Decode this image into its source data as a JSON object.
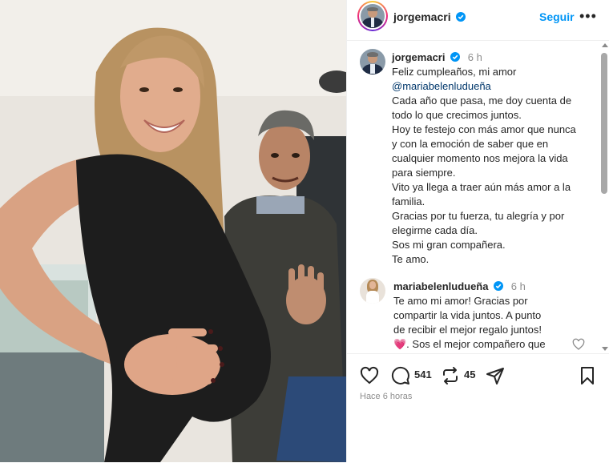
{
  "header": {
    "username": "jorgemacri",
    "follow_label": "Seguir",
    "more_label": "•••"
  },
  "caption": {
    "username": "jorgemacri",
    "time": "6 h",
    "lines": [
      "Feliz cumpleaños, mi amor",
      "@mariabelenludueña",
      "Cada año que pasa, me doy cuenta de",
      "todo lo que crecimos juntos.",
      "Hoy te festejo con más amor que nunca",
      "y con la emoción de saber que en",
      "cualquier momento nos mejora la vida",
      "para siempre.",
      "Vito ya llega a traer aún más amor a la",
      "familia.",
      "Gracias por tu fuerza, tu alegría y por",
      "elegirme cada día.",
      "Sos mi gran compañera.",
      "Te amo."
    ]
  },
  "reply": {
    "username": "mariabelenludueña",
    "time": "6 h",
    "lines": [
      "Te amo mi amor! Gracias por",
      "compartir la vida juntos. A punto",
      "de recibir el mejor regalo juntos!",
      "💗. Sos el mejor compañero que"
    ]
  },
  "actions": {
    "comment_count": "541",
    "repost_count": "45",
    "time_ago": "Hace 6 horas"
  },
  "colors": {
    "accent": "#0095f6",
    "verified": "#0095f6",
    "text": "#262626",
    "muted": "#8e8e8e",
    "mention": "#00376b"
  },
  "icons": {
    "like": "heart-icon",
    "comment": "comment-icon",
    "repost": "repost-icon",
    "share": "send-icon",
    "save": "bookmark-icon",
    "verified": "verified-badge-icon"
  }
}
